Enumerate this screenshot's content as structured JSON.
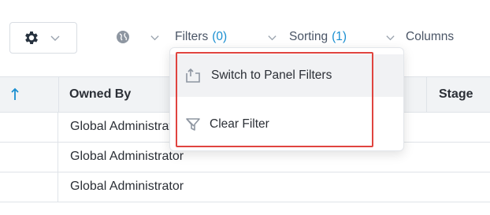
{
  "toolbar": {
    "settings_icon": "gear-icon",
    "globe_icon": "globe-icon",
    "filters": {
      "label": "Filters",
      "count": "(0)"
    },
    "sorting": {
      "label": "Sorting",
      "count": "(1)"
    },
    "columns": {
      "label": "Columns"
    }
  },
  "table": {
    "sort_icon": "arrow-up-icon",
    "headers": {
      "owned_by": "Owned By",
      "stage": "Stage"
    },
    "rows": [
      {
        "owned_by": "Global Administrator"
      },
      {
        "owned_by": "Global Administrator"
      },
      {
        "owned_by": "Global Administrator"
      }
    ]
  },
  "filter_menu": {
    "items": [
      {
        "label": "Switch to Panel Filters",
        "icon": "panel-switch-icon"
      },
      {
        "label": "Clear Filter",
        "icon": "filter-clear-icon"
      }
    ],
    "highlight_color": "#e0443f"
  },
  "colors": {
    "accent": "#1a8fd1",
    "header_bg": "#f1f3f5",
    "gear": "#27323f"
  }
}
